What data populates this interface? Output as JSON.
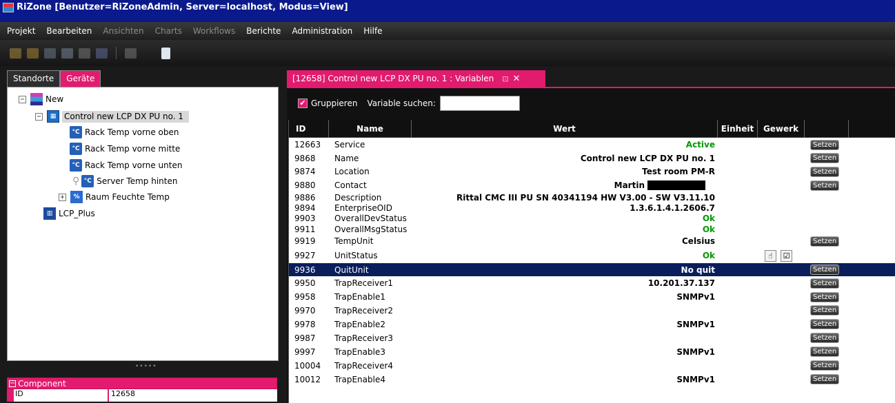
{
  "window": {
    "title": "RiZone [Benutzer=RiZoneAdmin, Server=localhost, Modus=View]"
  },
  "menu": [
    {
      "label": "Projekt",
      "enabled": true
    },
    {
      "label": "Bearbeiten",
      "enabled": true
    },
    {
      "label": "Ansichten",
      "enabled": false
    },
    {
      "label": "Charts",
      "enabled": false
    },
    {
      "label": "Workflows",
      "enabled": false
    },
    {
      "label": "Berichte",
      "enabled": true
    },
    {
      "label": "Administration",
      "enabled": true
    },
    {
      "label": "Hilfe",
      "enabled": true
    }
  ],
  "left": {
    "tabs": [
      "Standorte",
      "Geräte"
    ],
    "active_tab": "Geräte",
    "tree": [
      {
        "label": "New",
        "icon": "site-icon",
        "expander": "−"
      },
      {
        "label": "Control new LCP DX PU no. 1",
        "icon": "controller-icon",
        "expander": "−"
      },
      {
        "label": "Rack Temp vorne oben",
        "icon": "temperature-sensor-icon"
      },
      {
        "label": "Rack Temp vorne mitte",
        "icon": "temperature-sensor-icon"
      },
      {
        "label": "Rack Temp vorne unten",
        "icon": "temperature-sensor-icon"
      },
      {
        "label": "Server Temp hinten",
        "icon": "temperature-sensor-icon"
      },
      {
        "label": "Raum Feuchte Temp",
        "icon": "humidity-sensor-icon",
        "expander": "+"
      },
      {
        "label": "LCP_Plus",
        "icon": "lcp-icon"
      }
    ],
    "component": {
      "header": "Component",
      "rows": [
        {
          "key": "ID",
          "value": "12658"
        }
      ]
    }
  },
  "doc": {
    "tab_title": "[12658] Control new LCP DX PU no. 1 : Variablen",
    "group_label": "Gruppieren",
    "search_label": "Variable suchen:",
    "search_value": "",
    "columns": {
      "id": "ID",
      "name": "Name",
      "wert": "Wert",
      "einheit": "Einheit",
      "gewerk": "Gewerk"
    },
    "setzen_label": "Setzen",
    "rows": [
      {
        "id": "12663",
        "name": "Service",
        "value": "Active",
        "green": true,
        "setzen": true
      },
      {
        "id": "9868",
        "name": "Name",
        "value": "Control new LCP DX PU no. 1",
        "setzen": true
      },
      {
        "id": "9874",
        "name": "Location",
        "value": "Test room PM-R",
        "setzen": true
      },
      {
        "id": "9880",
        "name": "Contact",
        "value": "Martin",
        "setzen": true,
        "redacted": true
      },
      {
        "id": "9886",
        "name": "Description",
        "value": "Rittal CMC III PU SN 40341194 HW V3.00 - SW V3.11.10"
      },
      {
        "id": "9894",
        "name": "EnterpriseOID",
        "value": "1.3.6.1.4.1.2606.7"
      },
      {
        "id": "9903",
        "name": "OverallDevStatus",
        "value": "Ok",
        "green": true
      },
      {
        "id": "9911",
        "name": "OverallMsgStatus",
        "value": "Ok",
        "green": true
      },
      {
        "id": "9919",
        "name": "TempUnit",
        "value": "Celsius",
        "setzen": true
      },
      {
        "id": "9927",
        "name": "UnitStatus",
        "value": "Ok",
        "green": true
      },
      {
        "id": "9936",
        "name": "QuitUnit",
        "value": "No quit",
        "setzen": true,
        "selected": true
      },
      {
        "id": "9950",
        "name": "TrapReceiver1",
        "value": "10.201.37.137",
        "setzen": true
      },
      {
        "id": "9958",
        "name": "TrapEnable1",
        "value": "SNMPv1",
        "setzen": true
      },
      {
        "id": "9970",
        "name": "TrapReceiver2",
        "value": "",
        "setzen": true
      },
      {
        "id": "9978",
        "name": "TrapEnable2",
        "value": "SNMPv1",
        "setzen": true
      },
      {
        "id": "9987",
        "name": "TrapReceiver3",
        "value": "",
        "setzen": true
      },
      {
        "id": "9997",
        "name": "TrapEnable3",
        "value": "SNMPv1",
        "setzen": true
      },
      {
        "id": "10004",
        "name": "TrapReceiver4",
        "value": "",
        "setzen": true
      },
      {
        "id": "10012",
        "name": "TrapEnable4",
        "value": "SNMPv1",
        "setzen": true
      }
    ]
  },
  "colors": {
    "accent": "#e21b6e",
    "title_bar": "#0a1a8c",
    "selection": "#0a1e5c",
    "ok_green": "#009900"
  }
}
